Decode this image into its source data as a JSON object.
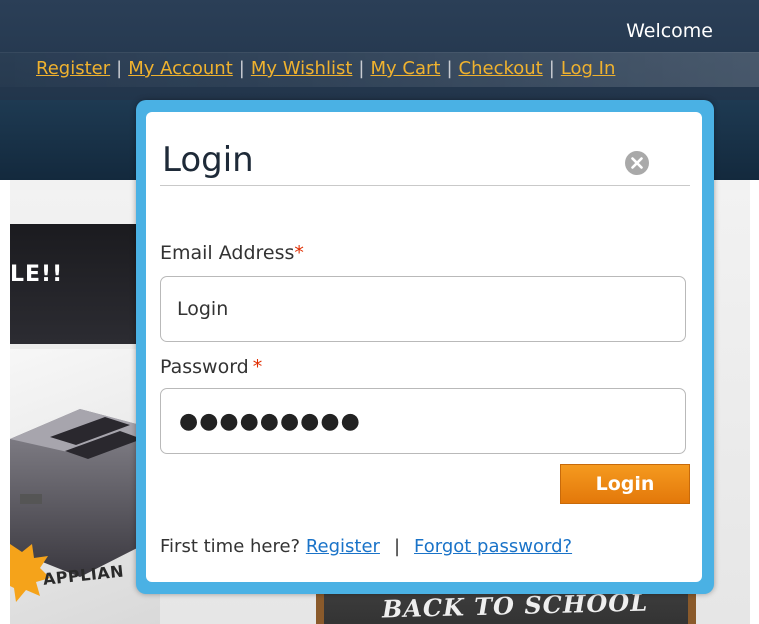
{
  "header": {
    "welcome_text": "Welcome",
    "links": {
      "register": "Register",
      "my_account": "My Account",
      "my_wishlist": "My Wishlist",
      "my_cart": "My Cart",
      "checkout": "Checkout",
      "log_in": "Log In"
    },
    "separator": "|"
  },
  "background": {
    "banner_text": "LE!!",
    "appliance_text": "APPLIAN",
    "chalkboard_text": "BACK TO SCHOOL"
  },
  "login_modal": {
    "title": "Login",
    "close_icon": "close-icon",
    "email_label": "Email Address",
    "password_label": "Password",
    "required_marker": "*",
    "email_value": "Login",
    "password_masked": "●●●●●●●●●",
    "login_button": "Login",
    "first_time_text": "First time here?",
    "register_link": "Register",
    "separator": "|",
    "forgot_password_link": "Forgot password?"
  },
  "colors": {
    "header_bg": "#22354b",
    "link_color": "#f0b22e",
    "modal_border": "#4ab1e4",
    "button_bg": "#f08c14",
    "required_color": "#e02d00",
    "modal_link_color": "#1a73c8"
  }
}
